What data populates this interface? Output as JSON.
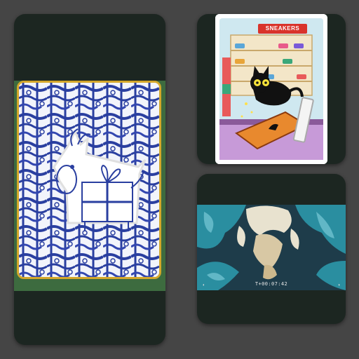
{
  "cards": [
    {
      "id": "goat-card",
      "thumbnail": "blue-line-drawing goat carrying a gift box on patterned background"
    },
    {
      "id": "sneaker-card",
      "sign_text": "SNEAKERS",
      "thumbnail": "black cat leaping in a sneaker shop"
    },
    {
      "id": "video-card",
      "timecode": "T+00:07:42",
      "thumbnail": "teal and cream crumpled sculpture"
    }
  ],
  "colors": {
    "page_bg": "#454545",
    "tile_bg": "#1c2621",
    "goat_blue": "#2a3fa0",
    "gold_frame": "#d4a72c",
    "sign_red": "#d9332b",
    "teal": "#2a8ea0"
  }
}
